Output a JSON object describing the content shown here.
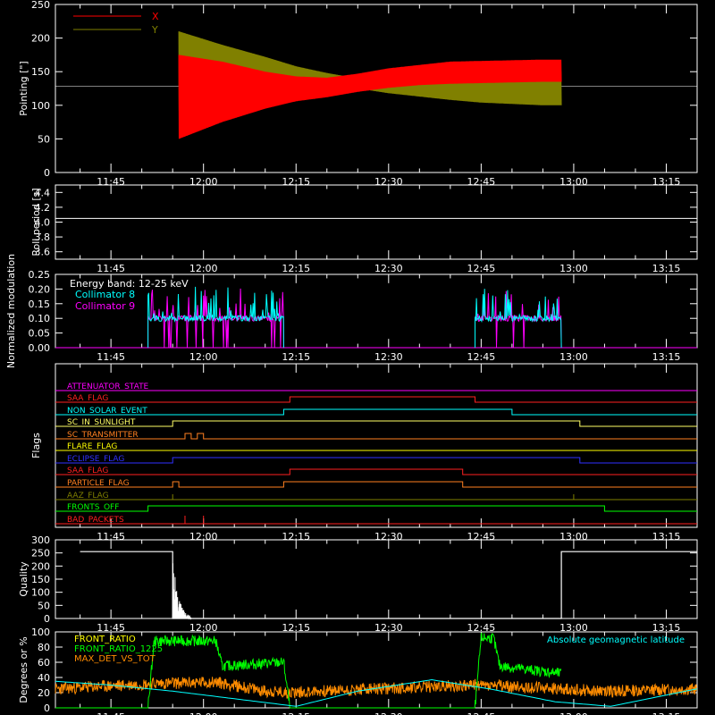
{
  "figure": {
    "background": "#000000",
    "foreground": "#ffffff",
    "time_ticks": [
      "11:45",
      "12:00",
      "12:15",
      "12:30",
      "12:45",
      "13:00",
      "13:15"
    ]
  },
  "chart_data": [
    {
      "type": "line",
      "ylabel": "Pointing [\"]",
      "ylim": [
        0,
        250
      ],
      "yticks": [
        "0",
        "50",
        "100",
        "150",
        "200",
        "250"
      ],
      "grid": false,
      "legend": "top-left",
      "reference_line": 128,
      "series": [
        {
          "name": "X",
          "color": "#ff0000",
          "time": [
            "11:56",
            "12:03",
            "12:10",
            "12:15",
            "12:20",
            "12:25",
            "12:30",
            "12:35",
            "12:40",
            "12:45",
            "12:50",
            "12:55",
            "12:58"
          ],
          "upper": [
            175,
            165,
            150,
            143,
            141,
            147,
            155,
            160,
            165,
            166,
            167,
            168,
            168
          ],
          "lower": [
            50,
            75,
            95,
            106,
            112,
            120,
            126,
            130,
            132,
            133,
            134,
            135,
            135
          ]
        },
        {
          "name": "Y",
          "color": "#808000",
          "time": [
            "11:56",
            "12:03",
            "12:10",
            "12:15",
            "12:20",
            "12:25",
            "12:30",
            "12:35",
            "12:40",
            "12:45",
            "12:50",
            "12:55",
            "12:58"
          ],
          "upper": [
            210,
            190,
            172,
            158,
            148,
            140,
            140,
            142,
            145,
            148,
            150,
            150,
            150
          ],
          "lower": [
            92,
            100,
            113,
            122,
            130,
            125,
            118,
            113,
            108,
            104,
            102,
            100,
            100
          ]
        }
      ]
    },
    {
      "type": "line",
      "ylabel": "Roll period [s]",
      "ylim": [
        3.5,
        4.5
      ],
      "yticks": [
        "3.6",
        "3.8",
        "4.0",
        "4.2",
        "4.4"
      ],
      "grid": false,
      "series": [
        {
          "color": "#ffffff",
          "time": [
            "11:36",
            "13:20"
          ],
          "values": [
            4.05,
            4.05
          ]
        }
      ]
    },
    {
      "type": "line",
      "ylabel": "Normalized modulation",
      "ylim": [
        0,
        0.25
      ],
      "yticks": [
        "0.00",
        "0.05",
        "0.10",
        "0.15",
        "0.20",
        "0.25"
      ],
      "grid": false,
      "legend": "top-left",
      "annotation": "Energy band: 12-25 keV",
      "active_intervals": [
        [
          "11:51",
          "12:13"
        ],
        [
          "12:44",
          "12:58"
        ]
      ],
      "typical_value": 0.1,
      "series": [
        {
          "name": "Collimator 8",
          "color": "#00ffff"
        },
        {
          "name": "Collimator 9",
          "color": "#ff00ff"
        }
      ]
    },
    {
      "type": "line",
      "ylabel": "Flags",
      "grid": false,
      "series": [
        {
          "name": "ATTENUATOR_STATE",
          "color": "#ff00ff",
          "changes": []
        },
        {
          "name": "SAA_FLAG",
          "color": "#ff2020",
          "changes": [
            "12:14",
            "12:44"
          ]
        },
        {
          "name": "NON_SOLAR_EVENT",
          "color": "#00ffff",
          "changes": [
            "12:13",
            "12:50"
          ]
        },
        {
          "name": "SC_IN_SUNLIGHT",
          "color": "#ffff66",
          "changes": [
            "11:55",
            "13:01"
          ]
        },
        {
          "name": "SC_TRANSMITTER",
          "color": "#ff8020",
          "changes": [
            "11:57",
            "11:58",
            "11:59",
            "12:00"
          ]
        },
        {
          "name": "FLARE_FLAG",
          "color": "#ffff00",
          "changes": []
        },
        {
          "name": "ECLIPSE_FLAG",
          "color": "#3030ff",
          "changes": [
            "11:55",
            "13:01"
          ]
        },
        {
          "name": "SAA_FLAG",
          "color": "#ff2020",
          "changes": [
            "12:14",
            "12:42"
          ]
        },
        {
          "name": "PARTICLE_FLAG",
          "color": "#ff8020",
          "changes": [
            "11:55",
            "11:56",
            "12:13",
            "12:42"
          ]
        },
        {
          "name": "AAZ_FLAG",
          "color": "#808000",
          "changes": [
            "11:55",
            "11:55",
            "13:00",
            "13:00"
          ]
        },
        {
          "name": "FRONTS_OFF",
          "color": "#00ff00",
          "changes": [
            "11:51",
            "13:05"
          ]
        },
        {
          "name": "BAD_PACKETS",
          "color": "#ff2020",
          "changes": []
        }
      ]
    },
    {
      "type": "bar",
      "ylabel": "Quality",
      "ylim": [
        0,
        300
      ],
      "yticks": [
        "0",
        "50",
        "100",
        "150",
        "200",
        "250",
        "300"
      ],
      "grid": false,
      "series": [
        {
          "color": "#ffffff",
          "time": [
            "11:40",
            "11:55",
            "11:55",
            "12:58",
            "12:58",
            "13:20"
          ],
          "values": [
            255,
            255,
            0,
            0,
            255,
            255
          ]
        }
      ]
    },
    {
      "type": "line",
      "ylabel": "Degrees or %",
      "ylim": [
        0,
        100
      ],
      "yticks": [
        "0",
        "20",
        "40",
        "60",
        "80",
        "100"
      ],
      "grid": false,
      "legend": "top-left",
      "series": [
        {
          "name": "FRONT_RATIO",
          "color": "#ffff00"
        },
        {
          "name": "FRONT_RATIO_1225",
          "color": "#00ff00",
          "time": [
            "11:51",
            "11:52",
            "12:02",
            "12:03",
            "12:13",
            "12:14",
            "12:44",
            "12:45",
            "12:47",
            "12:48",
            "12:58"
          ],
          "values": [
            0,
            88,
            88,
            55,
            60,
            0,
            0,
            92,
            92,
            55,
            45
          ]
        },
        {
          "name": "MAX_DET_VS_TOT",
          "color": "#ff8c00",
          "time": [
            "11:36",
            "11:52",
            "12:02",
            "12:10",
            "12:13",
            "12:44",
            "12:58",
            "13:05",
            "13:20"
          ],
          "values": [
            25,
            32,
            34,
            22,
            20,
            30,
            25,
            22,
            25
          ]
        },
        {
          "name": "Absolute geomagnetic latitude",
          "color": "#00ffff",
          "time": [
            "11:36",
            "11:45",
            "11:55",
            "12:05",
            "12:15",
            "12:25",
            "12:37",
            "12:47",
            "12:57",
            "13:06",
            "13:20"
          ],
          "values": [
            35,
            30,
            22,
            12,
            2,
            22,
            37,
            24,
            8,
            2,
            25
          ]
        }
      ]
    }
  ]
}
